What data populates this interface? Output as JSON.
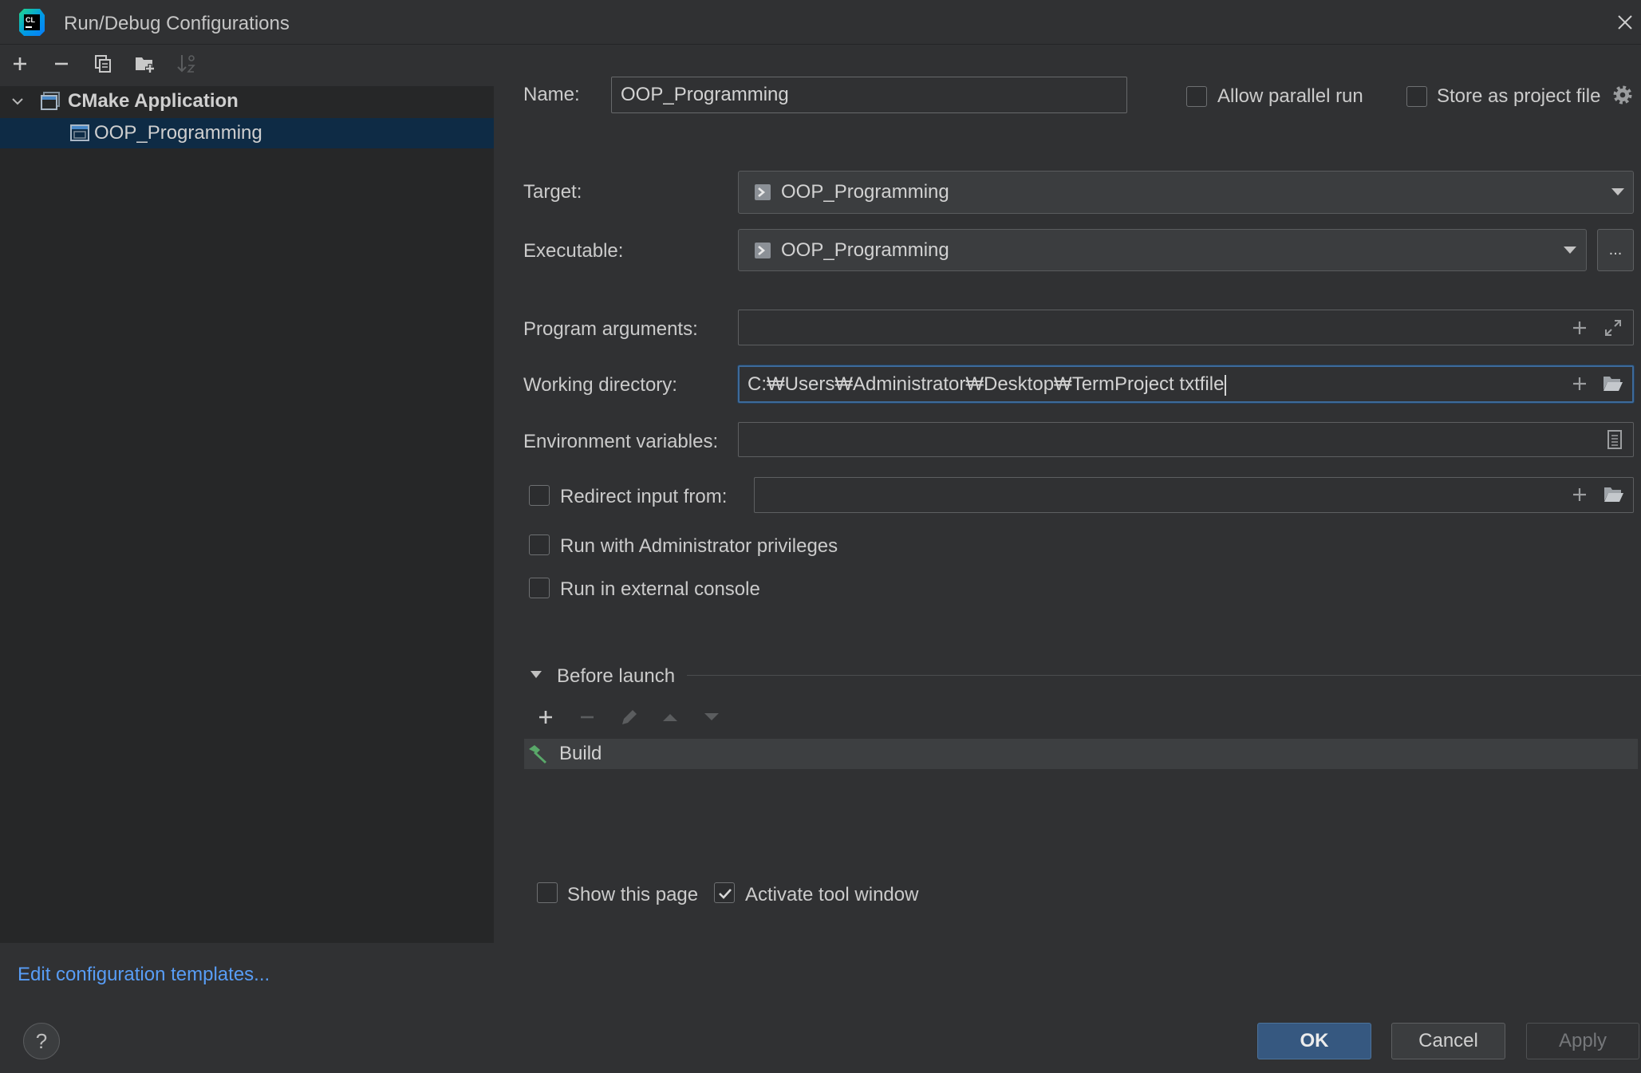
{
  "window": {
    "title": "Run/Debug Configurations",
    "logo_text": "CL"
  },
  "toolbar": {
    "items": [
      {
        "icon": "plus-icon",
        "enabled": true
      },
      {
        "icon": "minus-icon",
        "enabled": true
      },
      {
        "icon": "copy-icon",
        "enabled": true
      },
      {
        "icon": "folder-add-icon",
        "enabled": true
      },
      {
        "icon": "sort-icon",
        "enabled": false
      }
    ]
  },
  "tree": {
    "group": {
      "label": "CMake Application",
      "expanded": true,
      "icon": "cmake-application-icon"
    },
    "items": [
      {
        "label": "OOP_Programming",
        "selected": true,
        "icon": "run-config-icon"
      }
    ]
  },
  "form": {
    "name": {
      "label": "Name:",
      "value": "OOP_Programming"
    },
    "allow_parallel_run": {
      "label": "Allow parallel run",
      "checked": false
    },
    "store_as_project_file": {
      "label": "Store as project file",
      "checked": false
    },
    "target": {
      "label": "Target:",
      "value": "OOP_Programming",
      "icon": "executable-icon"
    },
    "executable": {
      "label": "Executable:",
      "value": "OOP_Programming",
      "icon": "executable-icon",
      "browse_label": "..."
    },
    "program_arguments": {
      "label": "Program arguments:",
      "value": ""
    },
    "working_directory": {
      "label": "Working directory:",
      "value": "C:₩Users₩Administrator₩Desktop₩TermProject txtfile",
      "focused": true
    },
    "environment_variables": {
      "label": "Environment variables:",
      "value": ""
    },
    "redirect_input": {
      "label": "Redirect input from:",
      "checked": false,
      "value": ""
    },
    "run_as_admin": {
      "label": "Run with Administrator privileges",
      "checked": false
    },
    "run_in_external_console": {
      "label": "Run in external console",
      "checked": false
    }
  },
  "before_launch": {
    "label": "Before launch",
    "expanded": true,
    "toolbar": [
      {
        "icon": "plus-icon",
        "enabled": true
      },
      {
        "icon": "minus-icon",
        "enabled": false
      },
      {
        "icon": "pencil-icon",
        "enabled": false
      },
      {
        "icon": "arrow-up-icon",
        "enabled": false
      },
      {
        "icon": "arrow-down-icon",
        "enabled": false
      }
    ],
    "tasks": [
      {
        "label": "Build",
        "icon": "hammer-icon"
      }
    ],
    "show_this_page": {
      "label": "Show this page",
      "checked": false
    },
    "activate_tool_window": {
      "label": "Activate tool window",
      "checked": true
    }
  },
  "footer": {
    "templates_link": "Edit configuration templates...",
    "help_label": "?",
    "ok_label": "OK",
    "cancel_label": "Cancel",
    "apply_label": "Apply",
    "apply_enabled": false
  },
  "colors": {
    "dialog_bg": "#303133",
    "tree_bg": "#262728",
    "selection_bg": "#0e2b45",
    "focus_border": "#3d6a9a",
    "link": "#589df6",
    "primary_button": "#365880",
    "build_row_bg": "#3d3f41"
  }
}
